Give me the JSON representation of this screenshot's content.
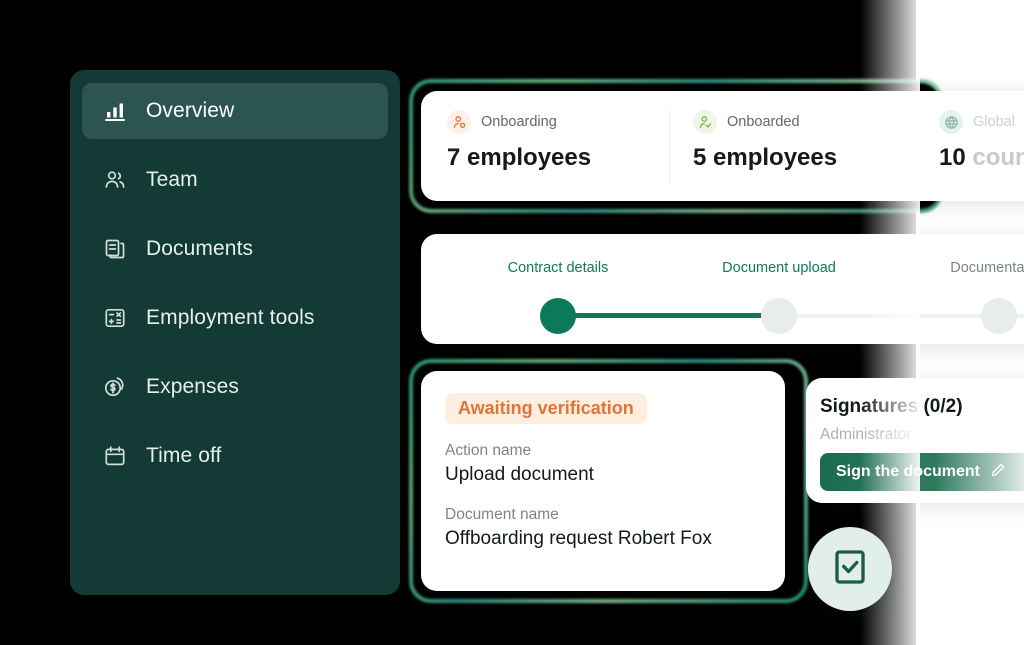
{
  "sidebar": {
    "items": [
      {
        "label": "Overview",
        "icon": "bar-chart-icon",
        "active": true
      },
      {
        "label": "Team",
        "icon": "people-icon",
        "active": false
      },
      {
        "label": "Documents",
        "icon": "documents-icon",
        "active": false
      },
      {
        "label": "Employment tools",
        "icon": "calculator-icon",
        "active": false
      },
      {
        "label": "Expenses",
        "icon": "coins-icon",
        "active": false
      },
      {
        "label": "Time off",
        "icon": "calendar-icon",
        "active": false
      }
    ]
  },
  "stats": {
    "items": [
      {
        "label": "Onboarding",
        "value": "7 employees",
        "icon": "user-pending-icon",
        "tint": "orange",
        "faded": false
      },
      {
        "label": "Onboarded",
        "value": "5 employees",
        "icon": "user-check-icon",
        "tint": "green",
        "faded": false
      },
      {
        "label": "Global",
        "value": "10 ",
        "unit": "countries",
        "icon": "globe-icon",
        "tint": "mint",
        "faded": true
      }
    ]
  },
  "stepper": {
    "steps": [
      {
        "label": "Contract details",
        "state": "done"
      },
      {
        "label": "Document upload",
        "state": "current"
      },
      {
        "label": "Documentation",
        "state": "todo"
      }
    ]
  },
  "action_card": {
    "status": "Awaiting verification",
    "action_name_label": "Action name",
    "action_name_value": "Upload document",
    "document_name_label": "Document name",
    "document_name_value": "Offboarding request Robert Fox"
  },
  "signatures": {
    "title": "Signatures (0/2)",
    "role": "Administrator",
    "button_label": "Sign the document",
    "button_icon": "pencil-icon"
  },
  "check_badge": {
    "icon": "document-check-icon"
  },
  "colors": {
    "sidebar_bg": "#133a34",
    "sidebar_active": "#2c5450",
    "accent_green": "#0f7a5a",
    "status_orange": "#e2743a",
    "status_orange_bg": "#fdeee0"
  }
}
